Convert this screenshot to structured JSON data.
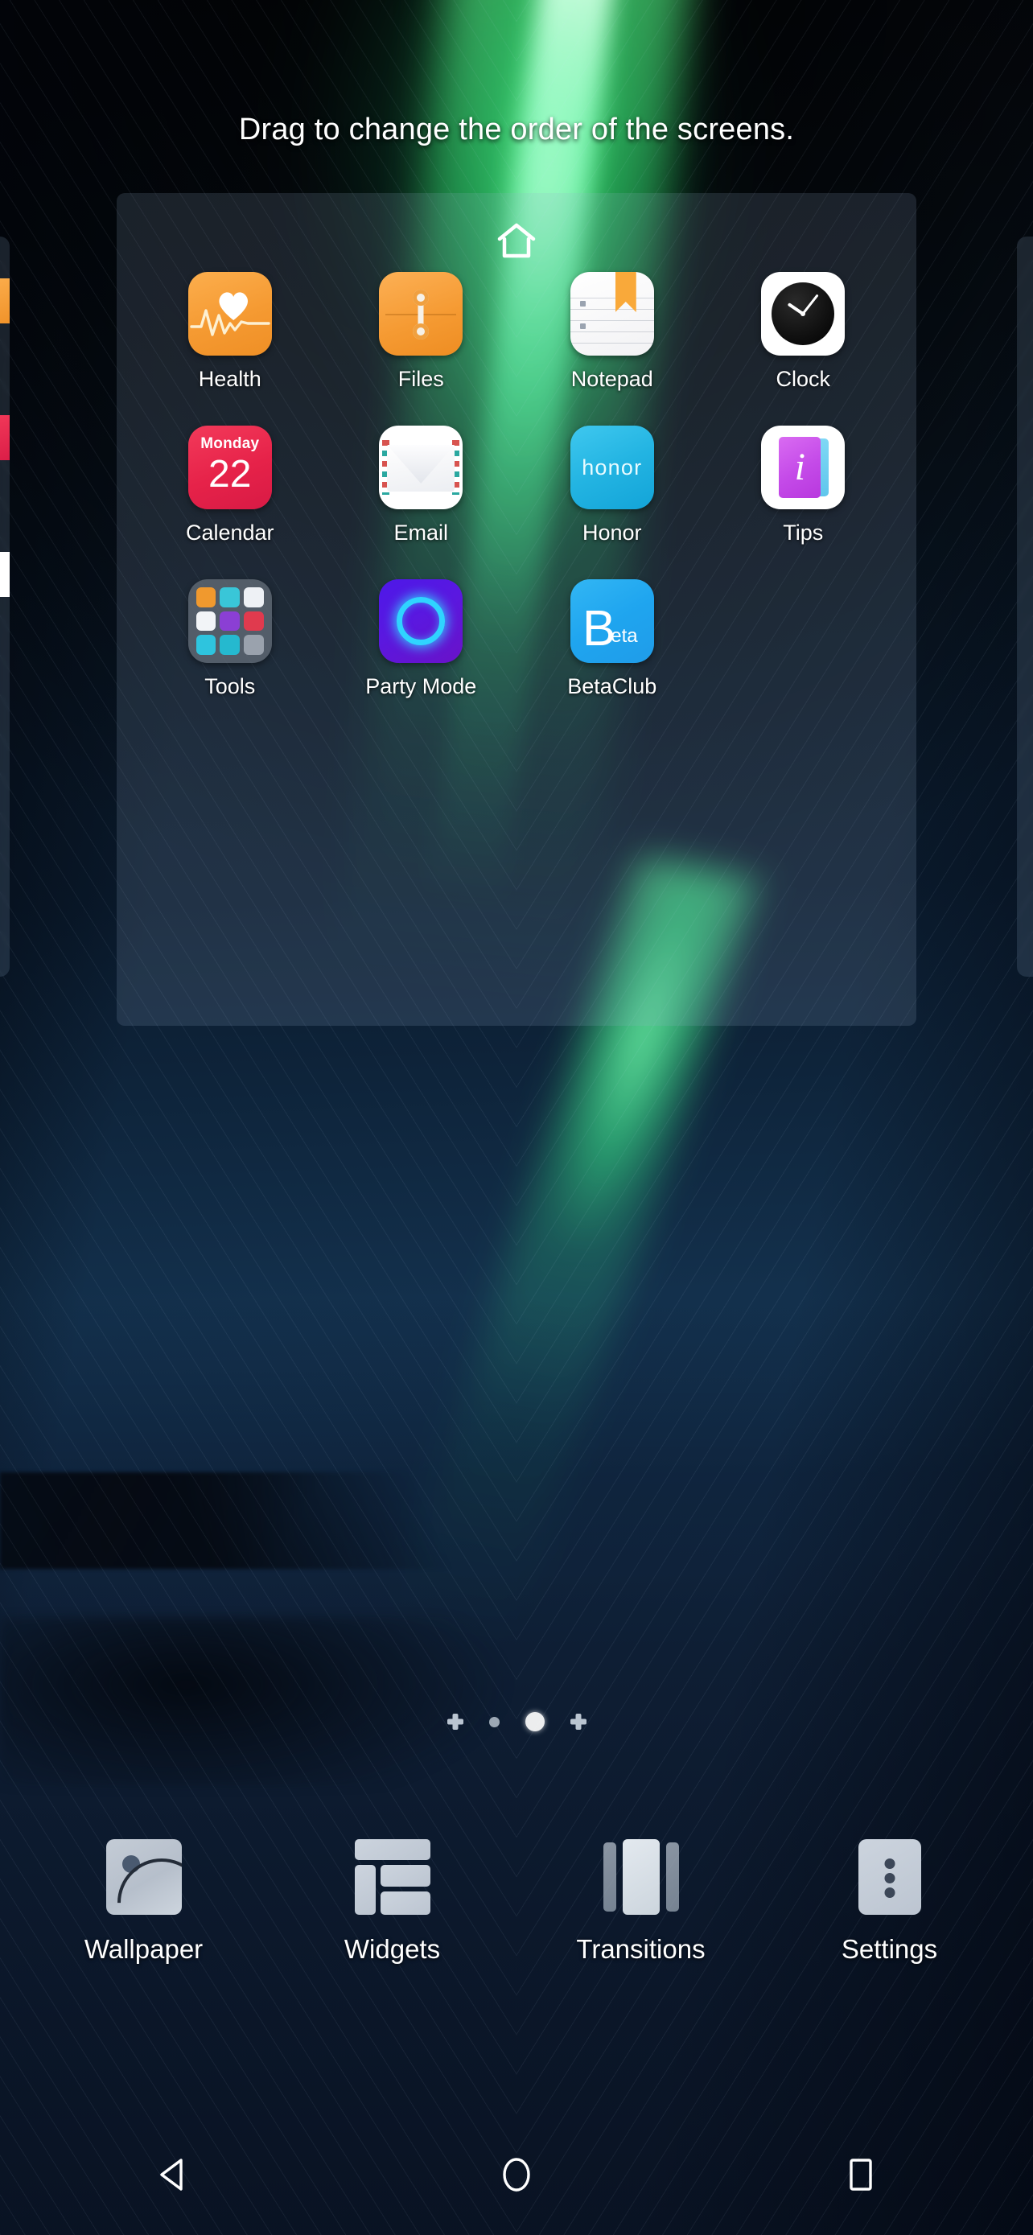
{
  "header": {
    "title": "Drag to change the order of the screens."
  },
  "screen_preview": {
    "home_marker_icon": "home-house-icon",
    "is_default_home": true,
    "apps": [
      {
        "label": "Health",
        "icon": "health-heart-ecg-icon",
        "bg": "#f59a32"
      },
      {
        "label": "Files",
        "icon": "files-folder-icon",
        "bg": "#f59a32"
      },
      {
        "label": "Notepad",
        "icon": "notepad-paper-icon",
        "bg": "#ffffff"
      },
      {
        "label": "Clock",
        "icon": "clock-analog-icon",
        "bg": "#ffffff"
      },
      {
        "label": "Calendar",
        "icon": "calendar-date-icon",
        "bg": "#e62249"
      },
      {
        "label": "Email",
        "icon": "email-envelope-icon",
        "bg": "#ffffff"
      },
      {
        "label": "Honor",
        "icon": "honor-brand-icon",
        "bg": "#23b4e2"
      },
      {
        "label": "Tips",
        "icon": "tips-info-card-icon",
        "bg": "#ffffff"
      },
      {
        "label": "Tools",
        "icon": "tools-folder-icon",
        "bg": "#606a76"
      },
      {
        "label": "Party Mode",
        "icon": "party-mode-ring-icon",
        "bg": "#5a18e0"
      },
      {
        "label": "BetaClub",
        "icon": "betaclub-b-icon",
        "bg": "#1fa5ef"
      }
    ],
    "calendar_icon_text": {
      "weekday": "Monday",
      "day": "22"
    },
    "honor_icon_text": "honor",
    "tips_icon_text": "i",
    "beta_icon_text": {
      "big": "B",
      "small": "eta"
    },
    "tools_folder_minis": [
      "#f0992e",
      "#39c6d8",
      "#eef1f5",
      "#f2f4f7",
      "#8b3fd4",
      "#e03a4e",
      "#2ec4de",
      "#25b9cf",
      "#9aa2ad"
    ]
  },
  "page_indicator": {
    "items": [
      {
        "type": "plus",
        "name": "add-page-left"
      },
      {
        "type": "dot",
        "name": "page-1",
        "active": false
      },
      {
        "type": "dot",
        "name": "page-2",
        "active": true
      },
      {
        "type": "plus",
        "name": "add-page-right"
      }
    ],
    "current_page": 2,
    "total_pages": 2
  },
  "toolbar": {
    "items": [
      {
        "label": "Wallpaper",
        "icon": "wallpaper-image-icon"
      },
      {
        "label": "Widgets",
        "icon": "widgets-grid-icon"
      },
      {
        "label": "Transitions",
        "icon": "transitions-panels-icon"
      },
      {
        "label": "Settings",
        "icon": "settings-kebab-icon"
      }
    ]
  },
  "navbar": {
    "items": [
      {
        "label": "Back",
        "icon": "back-triangle-icon"
      },
      {
        "label": "Home",
        "icon": "home-circle-icon"
      },
      {
        "label": "Recents",
        "icon": "recents-square-icon"
      }
    ]
  },
  "colors": {
    "accent_green": "#2fd45f",
    "sky_blue": "#16395a",
    "text_white": "#ffffff",
    "card_overlay": "rgba(150,178,208,0.165)"
  }
}
